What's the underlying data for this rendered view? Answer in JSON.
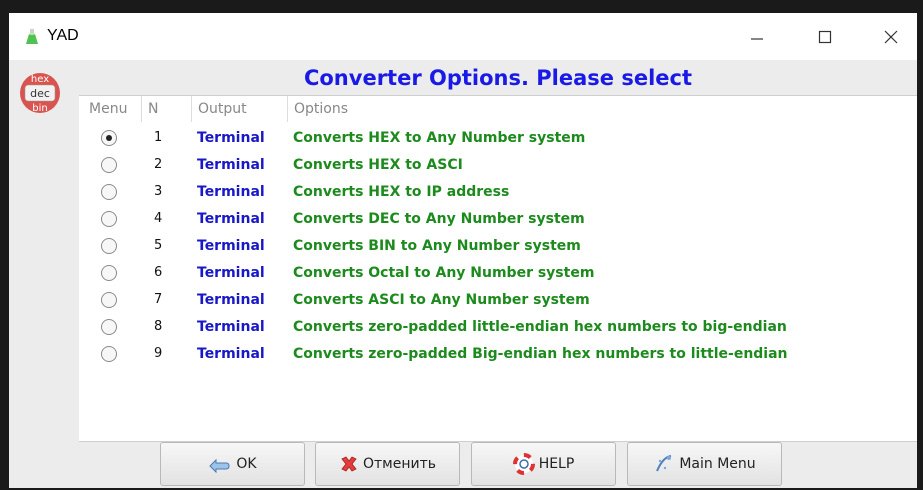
{
  "window": {
    "title": "YAD",
    "controls": [
      "minimize-icon",
      "maximize-icon",
      "close-icon"
    ]
  },
  "side_icon": {
    "label_lines": [
      "hex",
      "dec",
      "bin"
    ],
    "colors": {
      "red": "#d9544f",
      "mid": "#f2f2f2"
    }
  },
  "header": {
    "text": "Converter Options. Please select"
  },
  "columns": {
    "menu": "Menu",
    "n": "N",
    "output": "Output",
    "options": "Options"
  },
  "rows": [
    {
      "selected": true,
      "n": "1",
      "output": "Terminal",
      "option": "Converts HEX to Any Number system"
    },
    {
      "selected": false,
      "n": "2",
      "output": "Terminal",
      "option": "Converts HEX to ASCI"
    },
    {
      "selected": false,
      "n": "3",
      "output": "Terminal",
      "option": "Converts HEX to IP address"
    },
    {
      "selected": false,
      "n": "4",
      "output": "Terminal",
      "option": "Converts DEC to Any Number system"
    },
    {
      "selected": false,
      "n": "5",
      "output": "Terminal",
      "option": "Converts BIN to Any Number system"
    },
    {
      "selected": false,
      "n": "6",
      "output": "Terminal",
      "option": "Converts Octal to Any Number system"
    },
    {
      "selected": false,
      "n": "7",
      "output": "Terminal",
      "option": "Converts ASCI to Any Number system"
    },
    {
      "selected": false,
      "n": "8",
      "output": "Terminal",
      "option": "Converts zero-padded little-endian hex numbers to big-endian"
    },
    {
      "selected": false,
      "n": "9",
      "output": "Terminal",
      "option": "Converts zero-padded Big-endian hex numbers to little-endian"
    }
  ],
  "buttons": {
    "ok": "OK",
    "cancel": "Отменить",
    "help": "HELP",
    "main_menu": "Main Menu"
  },
  "colors": {
    "header": "#1a1ae6",
    "output": "#1818c8",
    "option": "#1c8a1c"
  }
}
